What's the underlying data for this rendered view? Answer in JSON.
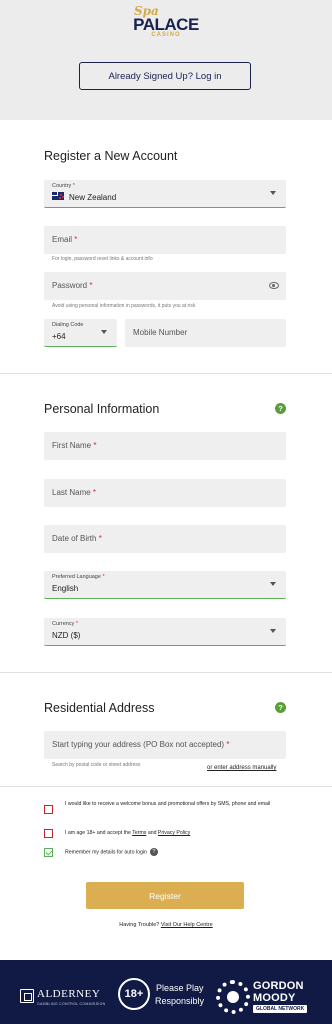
{
  "brand": {
    "logo_top": "Spa",
    "logo_main": "PALACE",
    "logo_sub": "CASINO"
  },
  "header": {
    "login_label": "Already Signed Up? Log in"
  },
  "register": {
    "title": "Register a New Account",
    "country": {
      "label": "Country",
      "value": "New Zealand"
    },
    "email": {
      "placeholder": "Email",
      "hint": "For login, password reset links & account info"
    },
    "password": {
      "placeholder": "Password",
      "hint": "Avoid using personal information in passwords, it puts you at risk"
    },
    "dialing": {
      "label": "Dialing Code",
      "value": "+64"
    },
    "mobile": {
      "placeholder": "Mobile Number"
    }
  },
  "personal": {
    "title": "Personal Information",
    "first_name": "First Name",
    "last_name": "Last Name",
    "dob": "Date of Birth",
    "language": {
      "label": "Preferred Language",
      "value": "English"
    },
    "currency": {
      "label": "Currency",
      "value": "NZD ($)"
    }
  },
  "address": {
    "title": "Residential Address",
    "placeholder": "Start typing your address (PO Box not accepted)",
    "hint": "Search by postal code or street address",
    "manual_link": "or enter address manually"
  },
  "consents": {
    "promo": "I would like to receive a welcome bonus and promotional offers by SMS, phone and email",
    "age_prefix": "I am age 18+ and accept the ",
    "terms": "Terms",
    "and": " and ",
    "privacy": "Privacy Policy",
    "remember": "Remember my details for auto login",
    "promo_checked": false,
    "age_checked": false,
    "remember_checked": true
  },
  "actions": {
    "register_label": "Register",
    "trouble_text": "Having Trouble? ",
    "help_link": "Visit Our Help Centre"
  },
  "footer": {
    "alderney": "ALDERNEY",
    "alderney_sub": "GAMBLING CONTROL COMMISSION",
    "age_badge": "18+",
    "rg_line1": "Please Play",
    "rg_line2": "Responsibly",
    "gm_line1": "GORDON",
    "gm_line2": "MOODY",
    "gm_line3": "GLOBAL NETWORK"
  },
  "colors": {
    "accent_gold": "#dbae52",
    "navy": "#1b2250",
    "success_green": "#5cae5a",
    "required_red": "#d0282e"
  }
}
